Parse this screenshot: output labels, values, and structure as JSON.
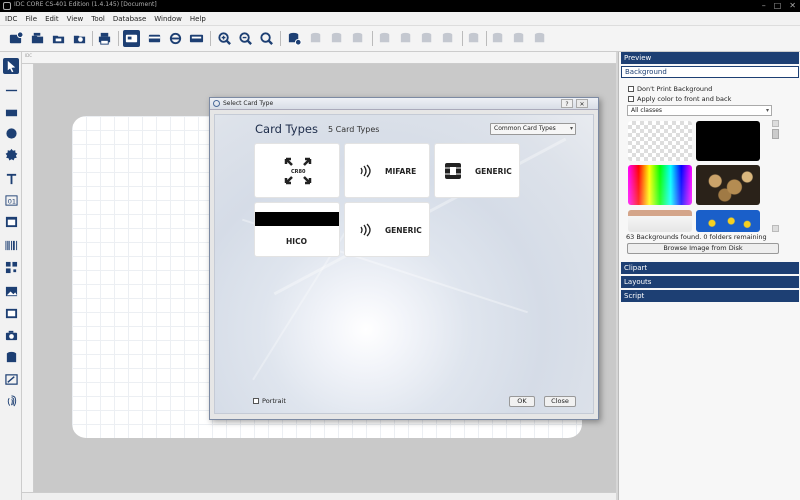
{
  "window": {
    "title": "IDC CORE CS-401 Edition  (1.4.145) [Document]",
    "controls": [
      "–",
      "□",
      "✕"
    ]
  },
  "menubar": [
    "IDC",
    "File",
    "Edit",
    "View",
    "Tool",
    "Database",
    "Window",
    "Help"
  ],
  "toolbar": {
    "icons": [
      "new-card-icon",
      "open-icon",
      "open-recent-icon",
      "save-icon",
      "print-icon",
      "front-side-icon",
      "back-side-icon",
      "encode-icon",
      "magstripe-icon",
      "zoom-in-icon",
      "zoom-out-icon",
      "zoom-fit-icon",
      "database-icon"
    ]
  },
  "left_tools": [
    "select-tool",
    "line-tool",
    "rectangle-tool",
    "ellipse-tool",
    "star-tool",
    "text-tool",
    "counter-tool",
    "date-tool",
    "barcode-tool",
    "qrcode-tool",
    "image-tool",
    "photo-tool",
    "camera-tool",
    "database-field-tool",
    "signature-tool",
    "fingerprint-tool"
  ],
  "ruler": {
    "label": "IDC"
  },
  "right_panel": {
    "preview_label": "Preview",
    "background_label": "Background",
    "dont_print_bg": "Don't Print Background",
    "apply_color": "Apply color to front and back",
    "class_select": "All classes",
    "thumbnails": [
      {
        "name": "transparent"
      },
      {
        "name": "black",
        "color": "#000000"
      },
      {
        "name": "rainbow"
      },
      {
        "name": "coins"
      },
      {
        "name": "coffee-cup"
      },
      {
        "name": "flowers"
      }
    ],
    "bg_status": "63 Backgrounds found. 0 folders remaining",
    "browse_button": "Browse Image from Disk",
    "clipart_label": "Clipart",
    "layouts_label": "Layouts",
    "script_label": "Script"
  },
  "dialog": {
    "title": "Select Card Type",
    "help": "?",
    "close_x": "✕",
    "heading": "Card Types",
    "count": "5 Card Types",
    "filter": "Common Card Types",
    "tiles": {
      "cr80_badge": "CR80",
      "mifare": "MIFARE",
      "generic_chip": "GENERIC",
      "hico": "HICO",
      "generic_rfid": "GENERIC"
    },
    "portrait": "Portrait",
    "ok": "OK",
    "close": "Close"
  },
  "colors": {
    "accent": "#1d3f73",
    "dialog_title_text": "#1d2c4a"
  }
}
